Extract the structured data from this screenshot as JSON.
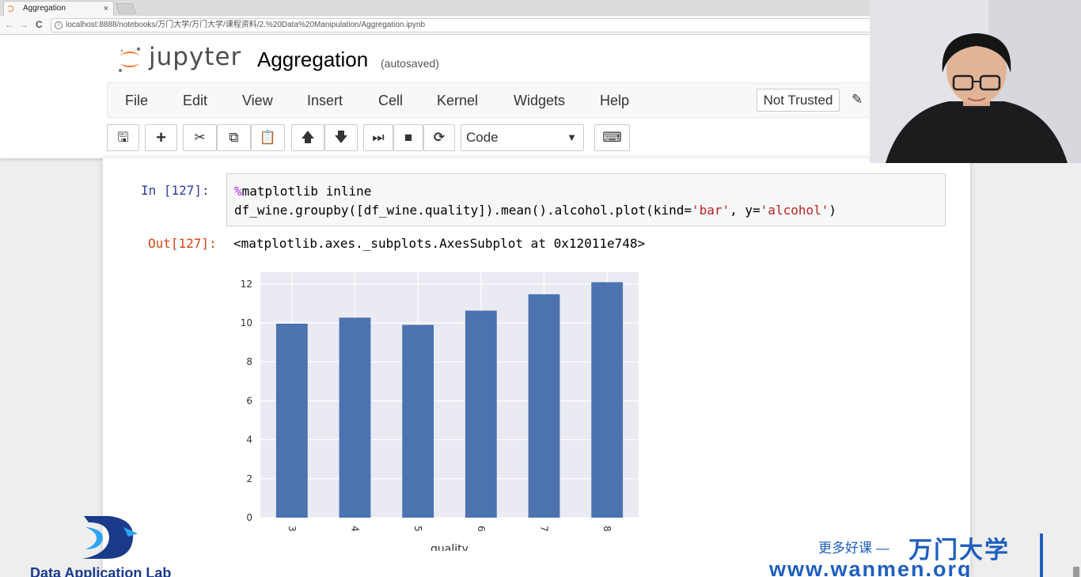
{
  "browser": {
    "tab_title": "Aggregation",
    "tab_close": "×",
    "url": "localhost:8888/notebooks/万门大学/万门大学/课程资料/2.%20Data%20Manipulation/Aggregation.ipynb",
    "back": "←",
    "forward": "→",
    "reload": "C",
    "info": "i"
  },
  "header": {
    "logo_text": "jupyter",
    "notebook_title": "Aggregation",
    "autosave": "(autosaved)",
    "trusted": "Not Trusted",
    "pencil": "✎"
  },
  "menu": [
    "File",
    "Edit",
    "View",
    "Insert",
    "Cell",
    "Kernel",
    "Widgets",
    "Help"
  ],
  "toolbar": {
    "save": "🖫",
    "add": "+",
    "cut": "✂",
    "copy": "⧉",
    "paste": "📋",
    "up": "🡅",
    "down": "🡇",
    "run": "⏭",
    "stop": "■",
    "restart": "⟳",
    "cell_type": "Code",
    "caret": "▼",
    "keyboard": "⌨"
  },
  "cell": {
    "in_prompt": "In  [127]:",
    "magic_symbol": "%",
    "code_line1_rest": "matplotlib inline",
    "code_line2_a": "df_wine.groupby([df_wine.quality]).mean().alcohol.plot(kind=",
    "code_line2_b": "'bar'",
    "code_line2_c": ", y=",
    "code_line2_d": "'alcohol'",
    "code_line2_e": ")",
    "out_prompt": "Out[127]:",
    "output_text": "<matplotlib.axes._subplots.AxesSubplot at 0x12011e748>"
  },
  "chart_data": {
    "type": "bar",
    "categories": [
      "3",
      "4",
      "5",
      "6",
      "7",
      "8"
    ],
    "values": [
      9.96,
      10.27,
      9.9,
      10.63,
      11.47,
      12.09
    ],
    "xlabel": "quality",
    "ylabel": "",
    "ylim": [
      0,
      12.6
    ],
    "yticks": [
      0,
      2,
      4,
      6,
      8,
      10,
      12
    ],
    "grid": true,
    "bar_color": "#4c72b0",
    "background": "#eaeaf2"
  },
  "watermark": {
    "lab_name": "Data Application Lab",
    "slogan": "更多好课 —",
    "brand": "万门大学",
    "site": "www.wanmen.org"
  },
  "colors": {
    "in_prompt": "#303f9f",
    "out_prompt": "#d84315",
    "brand_blue": "#1f5fbf"
  }
}
